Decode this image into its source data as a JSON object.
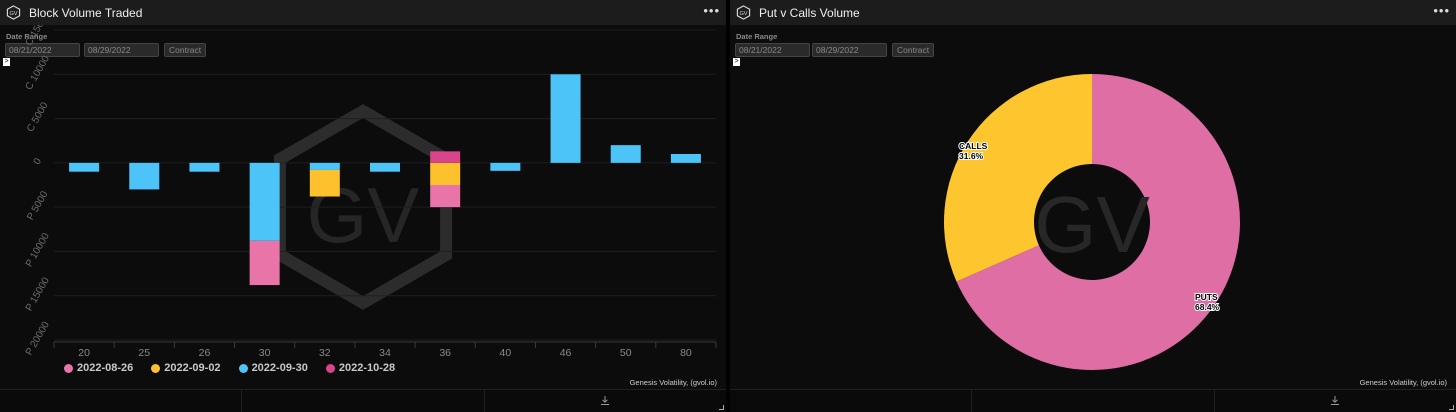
{
  "left_panel": {
    "title": "Block Volume Traded",
    "menu_icon": "ellipsis-icon",
    "date_range_label": "Date Range",
    "start_date": "08/21/2022",
    "end_date": "08/29/2022",
    "contract_button": "Contract",
    "expander": ">",
    "credit": "Genesis Volatility, (gvol.io)",
    "watermark": "GV"
  },
  "right_panel": {
    "title": "Put v Calls Volume",
    "menu_icon": "ellipsis-icon",
    "date_range_label": "Date Range",
    "start_date": "08/21/2022",
    "end_date": "08/29/2022",
    "contract_button": "Contract",
    "expander": ">",
    "credit": "Genesis Volatility, (gvol.io)",
    "watermark": "GV"
  },
  "colors": {
    "2022-08-26": "#e874a8",
    "2022-09-02": "#fcc12d",
    "2022-09-30": "#4cc4f8",
    "2022-10-28": "#d9448a",
    "calls": "#fec62e",
    "puts": "#df6ea5"
  },
  "chart_data": [
    {
      "type": "bar",
      "stacked": true,
      "categories": [
        "20",
        "25",
        "26",
        "30",
        "32",
        "34",
        "36",
        "40",
        "46",
        "50",
        "80"
      ],
      "ylim": [
        -20000,
        15000
      ],
      "y_ticks": [
        {
          "value": 15000,
          "label": "C 15000"
        },
        {
          "value": 10000,
          "label": "C 10000"
        },
        {
          "value": 5000,
          "label": "C 5000"
        },
        {
          "value": 0,
          "label": "0"
        },
        {
          "value": -5000,
          "label": "P 5000"
        },
        {
          "value": -10000,
          "label": "P 10000"
        },
        {
          "value": -15000,
          "label": "P 15000"
        },
        {
          "value": -20000,
          "label": "P 20000"
        }
      ],
      "series": [
        {
          "name": "2022-08-26",
          "values": [
            0,
            0,
            0,
            -5000,
            0,
            0,
            -2500,
            0,
            0,
            0,
            0
          ]
        },
        {
          "name": "2022-09-02",
          "values": [
            0,
            0,
            0,
            0,
            -3000,
            0,
            -2500,
            0,
            0,
            0,
            0
          ]
        },
        {
          "name": "2022-09-30",
          "values": [
            -1000,
            -3000,
            -1000,
            -8800,
            -800,
            -1000,
            0,
            -900,
            10000,
            2000,
            1000
          ]
        },
        {
          "name": "2022-10-28",
          "values": [
            0,
            0,
            0,
            0,
            0,
            0,
            1300,
            0,
            0,
            0,
            0
          ]
        }
      ],
      "legend_position": "bottom-left"
    },
    {
      "type": "pie",
      "donut": true,
      "labels": [
        "CALLS",
        "PUTS"
      ],
      "values": [
        31.6,
        68.4
      ],
      "value_labels": [
        "31.6%",
        "68.4%"
      ]
    }
  ]
}
